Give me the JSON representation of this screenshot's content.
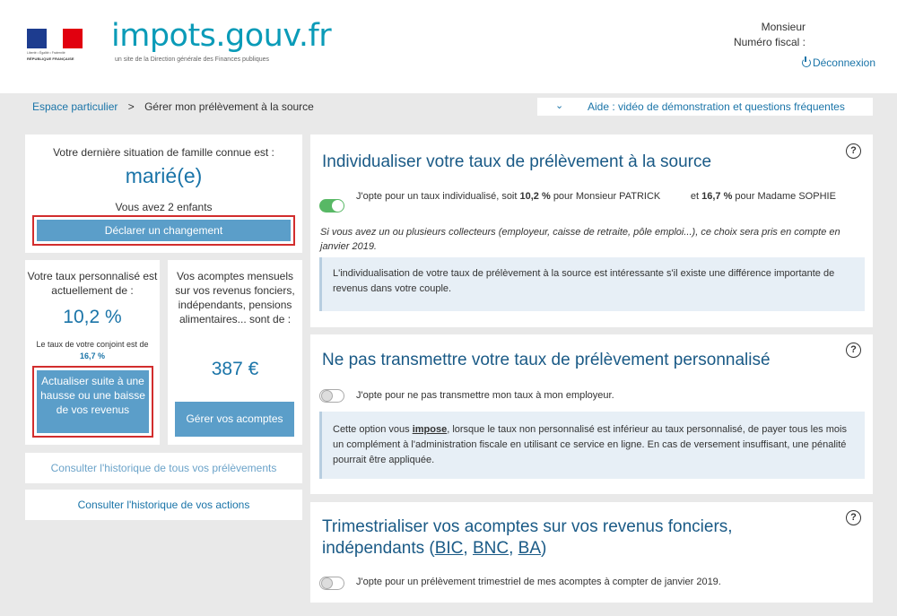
{
  "header": {
    "logo_text": "impots",
    "logo_dot": ".gouv.fr",
    "tagline": "un site de la Direction générale des Finances publiques",
    "republic_motto": "Liberté • Égalité • Fraternité",
    "republic_name": "RÉPUBLIQUE FRANÇAISE",
    "user_title": "Monsieur",
    "fiscal_label": "Numéro fiscal :",
    "logout_label": "Déconnexion"
  },
  "breadcrumb": {
    "home": "Espace particulier",
    "separator": ">",
    "current": "Gérer mon prélèvement à la source"
  },
  "help": {
    "label": "Aide : vidéo de démonstration et questions fréquentes"
  },
  "family": {
    "intro": "Votre dernière situation de famille connue est :",
    "status": "marié(e)",
    "children": "Vous avez 2 enfants",
    "change_button": "Déclarer un changement"
  },
  "rate": {
    "intro": "Votre taux personnalisé est actuellement de :",
    "value": "10,2 %",
    "spouse_text": "Le taux de votre conjoint est de",
    "spouse_value": "16,7 %",
    "update_button": "Actualiser suite à une hausse ou une baisse de vos revenus"
  },
  "acomptes": {
    "intro": "Vos acomptes mensuels sur vos revenus fonciers, indépendants, pensions alimentaires... sont de :",
    "value": "387 €",
    "manage_button": "Gérer vos acomptes"
  },
  "history": {
    "all_withholdings": "Consulter l'historique de tous vos prélèvements",
    "actions": "Consulter l'historique de vos actions"
  },
  "panels": {
    "individualize": {
      "title": "Individualiser votre taux de prélèvement à la source",
      "toggle_on": true,
      "opt_part1": "J'opte pour un taux individualisé, soit",
      "rate1": "10,2 %",
      "opt_part2": "pour Monsieur PATRICK",
      "opt_part3": "et",
      "rate2": "16,7 %",
      "opt_part4": "pour Madame SOPHIE",
      "note": "Si vous avez un ou plusieurs collecteurs (employeur, caisse de retraite, pôle emploi...), ce choix sera pris en compte en janvier 2019.",
      "info": "L'individualisation de votre taux de prélèvement à la source est intéressante s'il existe une différence importante de revenus dans votre couple."
    },
    "not_transmit": {
      "title": "Ne pas transmettre votre taux de prélèvement personnalisé",
      "toggle_on": false,
      "option": "J'opte pour ne pas transmettre mon taux à mon employeur.",
      "info_part1": "Cette option vous",
      "info_emph": "impose",
      "info_part2": ", lorsque le taux non personnalisé est inférieur au taux personnalisé, de payer tous les mois un complément à l'administration fiscale en utilisant ce service en ligne. En cas de versement insuffisant, une pénalité pourrait être appliquée."
    },
    "quarterly": {
      "title_part1": "Trimestrialiser vos acomptes sur vos revenus fonciers, indépendants (",
      "bic": "BIC",
      "sep1": ", ",
      "bnc": "BNC",
      "sep2": ", ",
      "ba": "BA",
      "title_end": ")",
      "toggle_on": false,
      "option": "J'opte pour un prélèvement trimestriel de mes acomptes à compter de janvier 2019."
    }
  },
  "icons": {
    "help": "question-circle-icon",
    "logout": "power-icon",
    "chevron": "chevron-down-icon"
  },
  "colors": {
    "brand": "#0a9bb8",
    "link": "#1a74a8",
    "button": "#5b9ec9",
    "toggle_on": "#58b865",
    "highlight_border": "#d22d2d"
  }
}
